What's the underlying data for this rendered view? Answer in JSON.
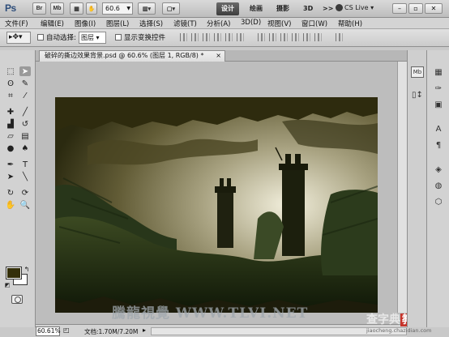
{
  "app": {
    "logo": "Ps",
    "buttons": [
      "Br",
      "Mb"
    ],
    "zoom_select": "60.6",
    "workspaces": [
      "设计",
      "绘画",
      "摄影",
      "3D",
      ">>"
    ],
    "active_workspace": "设计",
    "cs_live": "CS Live"
  },
  "menu": {
    "items": [
      "文件(F)",
      "编辑(E)",
      "图像(I)",
      "图层(L)",
      "选择(S)",
      "滤镜(T)",
      "分析(A)",
      "3D(D)",
      "视图(V)",
      "窗口(W)",
      "帮助(H)"
    ]
  },
  "options": {
    "auto_select_label": "自动选择:",
    "auto_select_value": "图层",
    "show_transform_label": "显示变换控件"
  },
  "document": {
    "tab_title": "破碎的撕边效果背景.psd @ 60.6% (图层 1, RGB/8) *",
    "tab_close": "×",
    "zoom_field": "60.61%",
    "doc_info": "文档:1.70M/7.20M"
  },
  "colors": {
    "foreground": "#342f09",
    "background": "#ffffff",
    "accent_active_tab": "#4a4a4a"
  },
  "watermark": {
    "site_text": "騰龍視覺 WWW.TLVI.NET",
    "brand_text_a": "查字典",
    "brand_text_b": "教程网",
    "brand_url": "jiaocheng.chazidian.com"
  },
  "tools": [
    "move-tool",
    "marquee-tool",
    "lasso-tool",
    "quick-select-tool",
    "crop-tool",
    "eyedropper-tool",
    "healing-brush-tool",
    "brush-tool",
    "clone-stamp-tool",
    "history-brush-tool",
    "eraser-tool",
    "gradient-tool",
    "blur-tool",
    "dodge-tool",
    "pen-tool",
    "type-tool",
    "path-select-tool",
    "shape-tool",
    "3d-rotate-tool",
    "3d-orbit-tool",
    "hand-tool",
    "zoom-tool"
  ]
}
